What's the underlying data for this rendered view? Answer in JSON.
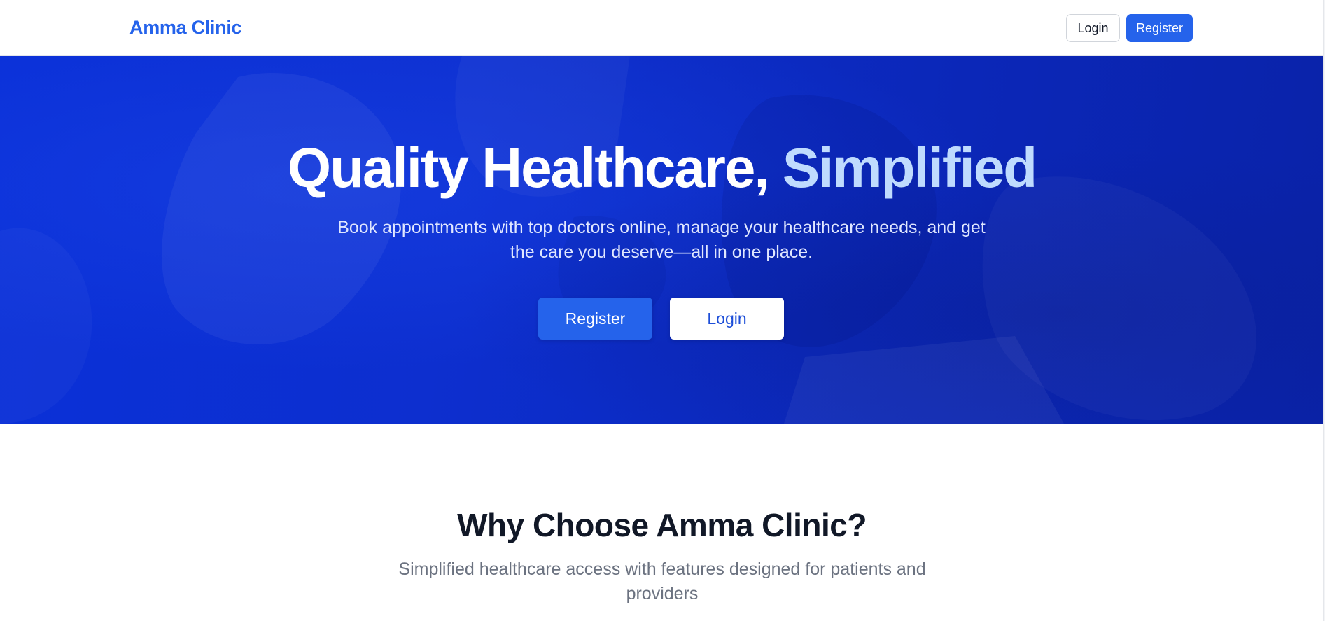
{
  "header": {
    "brand": "Amma Clinic",
    "login_label": "Login",
    "register_label": "Register"
  },
  "hero": {
    "title_main": "Quality Healthcare, ",
    "title_accent": "Simplified",
    "subtitle": "Book appointments with top doctors online, manage your healthcare needs, and get the care you deserve—all in one place.",
    "register_label": "Register",
    "login_label": "Login"
  },
  "features": {
    "title": "Why Choose Amma Clinic?",
    "subtitle": "Simplified healthcare access with features designed for patients and providers"
  },
  "colors": {
    "brand": "#2563eb",
    "hero_bg": "#0d2fcf",
    "accent_text": "#bfdbfe",
    "heading": "#111827",
    "muted": "#6b7280"
  },
  "icons": {
    "hero_background": "medical-photo-overlay"
  }
}
